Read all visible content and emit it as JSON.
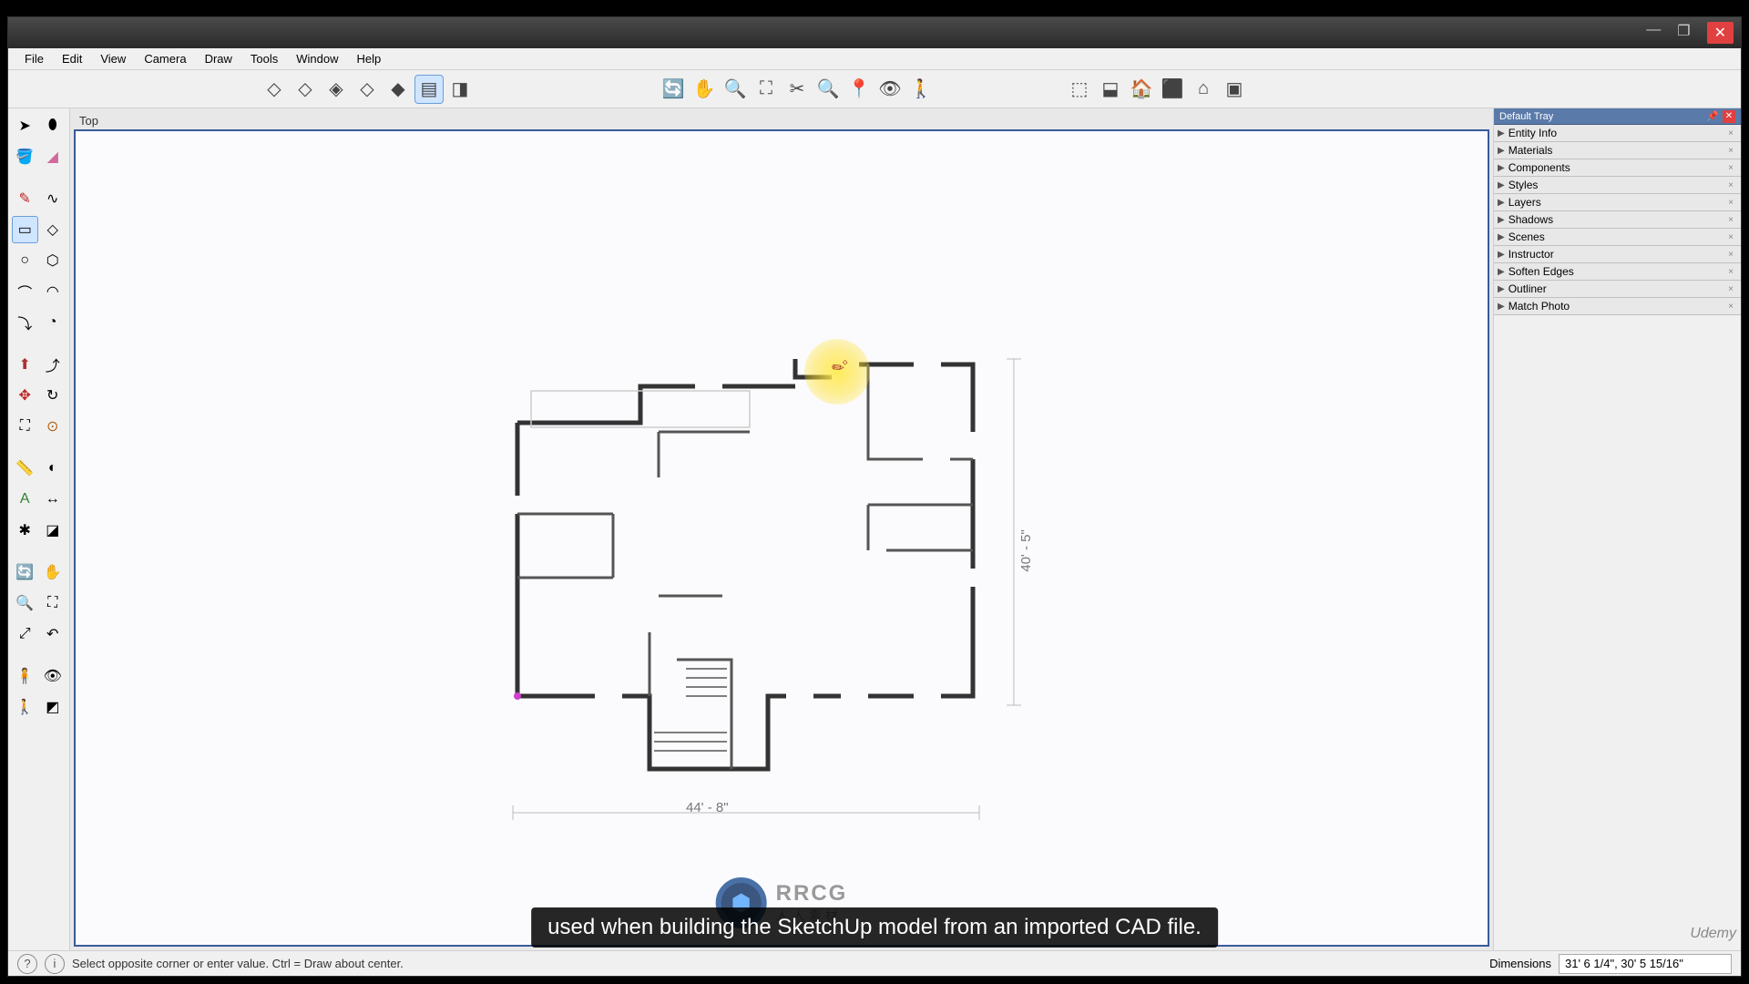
{
  "window": {
    "title": ""
  },
  "menu": {
    "items": [
      "File",
      "Edit",
      "View",
      "Camera",
      "Draw",
      "Tools",
      "Window",
      "Help"
    ]
  },
  "toolbars": {
    "views": [
      "iso",
      "iso2",
      "top",
      "front",
      "right",
      "back",
      "side",
      "pers"
    ],
    "camera": [
      "orbit",
      "pan",
      "zoom",
      "zoomwin",
      "zoomext",
      "prev",
      "look",
      "walk"
    ],
    "shadows": [
      "ext",
      "hid",
      "mono",
      "wire",
      "xray",
      "tex"
    ]
  },
  "left_tools": {
    "rows": [
      [
        "select",
        "eraser"
      ],
      [
        "line",
        "freehand"
      ],
      [
        "pencil",
        "arc"
      ],
      [
        "rectangle",
        "rotated-rect"
      ],
      [
        "circle",
        "polygon"
      ],
      [
        "arc2",
        "pie"
      ],
      [
        "arc3",
        "curve"
      ],
      [
        "pushpull",
        "follow"
      ],
      [
        "move",
        "rotate"
      ],
      [
        "scale",
        "offset"
      ],
      [
        "tape",
        "protractor"
      ],
      [
        "text",
        "dim"
      ],
      [
        "axes",
        "section"
      ],
      [
        "paint",
        "sample"
      ],
      [
        "orbit",
        "pan"
      ],
      [
        "zoom",
        "zoomwin"
      ],
      [
        "walk",
        "look"
      ],
      [
        "pos",
        "3d"
      ]
    ]
  },
  "viewport": {
    "label": "Top"
  },
  "right_tray": {
    "title": "Default Tray",
    "panels": [
      "Entity Info",
      "Materials",
      "Components",
      "Styles",
      "Layers",
      "Shadows",
      "Scenes",
      "Instructor",
      "Soften Edges",
      "Outliner",
      "Match Photo"
    ]
  },
  "status": {
    "hint": "Select opposite corner or enter value. Ctrl = Draw about center.",
    "measure_label": "Dimensions",
    "measure_value": "31' 6 1/4\", 30' 5 15/16\""
  },
  "floorplan": {
    "dim_h": "44' - 8\"",
    "dim_v": "40' - 5\""
  },
  "watermark": {
    "text": "RRCG",
    "sub": "人人素材"
  },
  "subtitle": "used when building the SketchUp model from an imported CAD file.",
  "udemy": "Udemy"
}
